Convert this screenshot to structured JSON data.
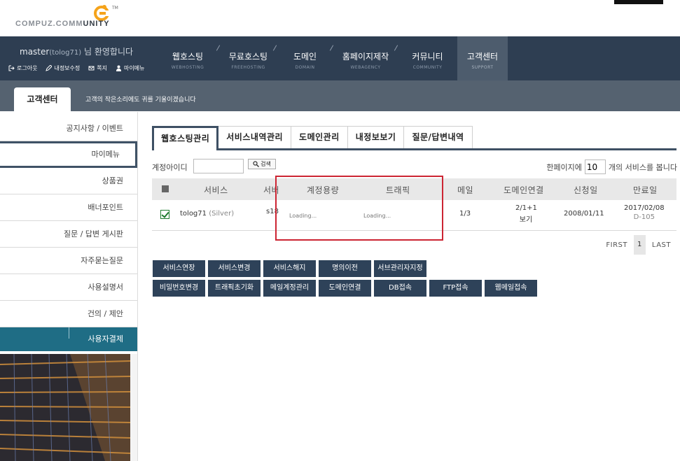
{
  "logo": {
    "text_light": "COMPUZ.COMM",
    "text_bold": "UNITY",
    "tm": "TM"
  },
  "user": {
    "name": "master",
    "id": "(tolog71)",
    "greeting": "님 환영합니다"
  },
  "user_links": [
    {
      "label": "로그아웃",
      "icon": "logout-icon"
    },
    {
      "label": "내정보수정",
      "icon": "pencil-icon"
    },
    {
      "label": "쪽지",
      "icon": "mail-icon"
    },
    {
      "label": "마이메뉴",
      "icon": "user-icon"
    }
  ],
  "gnb": [
    {
      "label": "웹호스팅",
      "sub": "WEBHOSTING"
    },
    {
      "label": "무료호스팅",
      "sub": "FREEHOSTING"
    },
    {
      "label": "도메인",
      "sub": "DOMAIN"
    },
    {
      "label": "홈페이지제작",
      "sub": "WEBAGENCY"
    },
    {
      "label": "커뮤니티",
      "sub": "COMMUNITY"
    },
    {
      "label": "고객센터",
      "sub": "SUPPORT"
    }
  ],
  "subheader": {
    "tab": "고객센터",
    "desc": "고객의 작은소리에도 귀를 기울이겠습니다"
  },
  "sidebar": [
    "공지사항 / 이벤트",
    "마이메뉴",
    "상품권",
    "배너포인트",
    "질문 / 답변 게시판",
    "자주묻는질문",
    "사용설명서",
    "건의 / 제안",
    "사용자결제"
  ],
  "tabs": [
    "웹호스팅관리",
    "서비스내역관리",
    "도메인관리",
    "내정보보기",
    "질문/답변내역"
  ],
  "search": {
    "label": "계정아이디",
    "value": "",
    "button": "검색",
    "perpage_prefix": "한페이지에",
    "perpage_value": "10",
    "perpage_suffix": "개의 서비스를 봅니다"
  },
  "table": {
    "headers": [
      "서비스",
      "서버",
      "계정용량",
      "트래픽",
      "메일",
      "도메인연결",
      "신청일",
      "만료일"
    ],
    "row": {
      "service": "tolog71",
      "plan": "(Silver)",
      "server": "s18",
      "quota": "Loading...",
      "traffic": "Loading...",
      "mail": "1/3",
      "domain": "2/1+1",
      "domain_link": "보기",
      "applied": "2008/01/11",
      "expires": "2017/02/08",
      "dday": "D-105"
    }
  },
  "pagination": {
    "first": "FIRST",
    "current": "1",
    "last": "LAST"
  },
  "buttons_row1": [
    "서비스연장",
    "서비스변경",
    "서비스해지",
    "명의이전",
    "서브관리자지정"
  ],
  "buttons_row2": [
    "비밀번호변경",
    "트래픽초기화",
    "메일계정관리",
    "도메인연결",
    "DB접속",
    "FTP접속",
    "웹메일접속"
  ],
  "colors": {
    "header": "#2e3e52",
    "subheader": "#556270",
    "button": "#2e4259",
    "sidebar_active": "#1f6d85",
    "highlight": "#cc2533"
  }
}
